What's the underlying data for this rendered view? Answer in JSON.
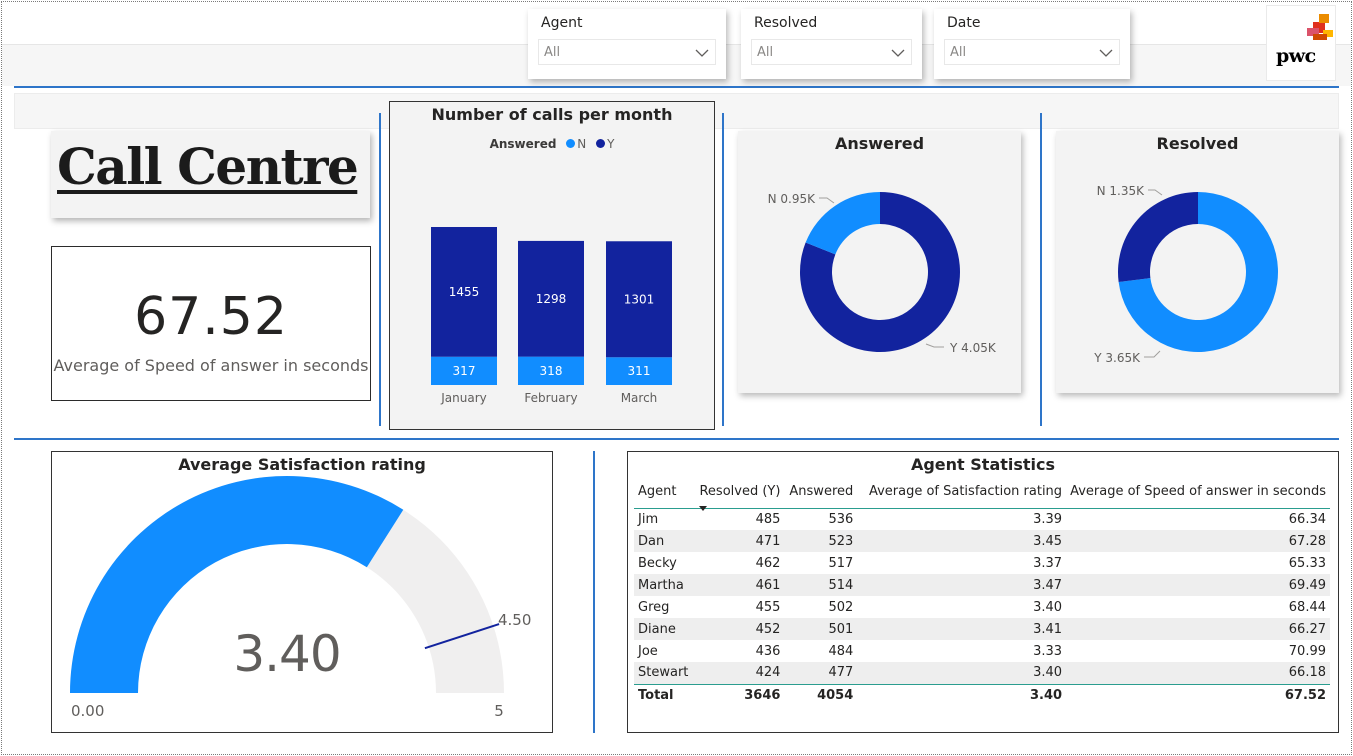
{
  "slicers": [
    {
      "label": "Agent",
      "value": "All"
    },
    {
      "label": "Resolved",
      "value": "All"
    },
    {
      "label": "Date",
      "value": "All"
    }
  ],
  "logo": {
    "text": "pwc"
  },
  "title": "Call Centre",
  "kpi": {
    "value": "67.52",
    "label": "Average of Speed of answer in seconds"
  },
  "colors": {
    "accent_dark": "#12239e",
    "accent_light": "#118dff",
    "divider": "#2e75c9",
    "gauge_track": "#f0efef"
  },
  "calls_chart": {
    "title": "Number of calls per month",
    "legend_title": "Answered",
    "chart_data": {
      "type": "bar",
      "stacked": true,
      "categories": [
        "January",
        "February",
        "March"
      ],
      "series": [
        {
          "name": "N",
          "color": "#118dff",
          "values": [
            317,
            318,
            311
          ]
        },
        {
          "name": "Y",
          "color": "#12239e",
          "values": [
            1455,
            1298,
            1301
          ]
        }
      ]
    }
  },
  "answered_donut": {
    "title": "Answered",
    "chart_data": {
      "type": "pie",
      "donut": true,
      "slices": [
        {
          "name": "N",
          "value": 0.95,
          "label": "N 0.95K",
          "color": "#118dff"
        },
        {
          "name": "Y",
          "value": 4.05,
          "label": "Y 4.05K",
          "color": "#12239e"
        }
      ]
    }
  },
  "resolved_donut": {
    "title": "Resolved",
    "chart_data": {
      "type": "pie",
      "donut": true,
      "slices": [
        {
          "name": "N",
          "value": 1.35,
          "label": "N 1.35K",
          "color": "#12239e"
        },
        {
          "name": "Y",
          "value": 3.65,
          "label": "Y 3.65K",
          "color": "#118dff"
        }
      ]
    }
  },
  "gauge": {
    "title": "Average Satisfaction rating",
    "value": 3.4,
    "value_label": "3.40",
    "min": 0,
    "min_label": "0.00",
    "max": 5,
    "max_label": "5",
    "target": 4.5,
    "target_label": "4.50"
  },
  "agent_table": {
    "title": "Agent Statistics",
    "columns": [
      "Agent",
      "Resolved (Y)",
      "Answered",
      "Average of Satisfaction rating",
      "Average of Speed of answer in seconds"
    ],
    "rows": [
      [
        "Jim",
        "485",
        "536",
        "3.39",
        "66.34"
      ],
      [
        "Dan",
        "471",
        "523",
        "3.45",
        "67.28"
      ],
      [
        "Becky",
        "462",
        "517",
        "3.37",
        "65.33"
      ],
      [
        "Martha",
        "461",
        "514",
        "3.47",
        "69.49"
      ],
      [
        "Greg",
        "455",
        "502",
        "3.40",
        "68.44"
      ],
      [
        "Diane",
        "452",
        "501",
        "3.41",
        "66.27"
      ],
      [
        "Joe",
        "436",
        "484",
        "3.33",
        "70.99"
      ],
      [
        "Stewart",
        "424",
        "477",
        "3.40",
        "66.18"
      ]
    ],
    "total": [
      "Total",
      "3646",
      "4054",
      "3.40",
      "67.52"
    ]
  }
}
